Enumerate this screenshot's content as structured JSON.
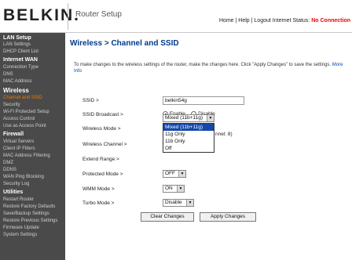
{
  "header": {
    "logo": "BELKIN",
    "logo_dot": ".",
    "title": "Router Setup",
    "nav_home": "Home",
    "nav_help": "Help",
    "nav_logout": "Logout",
    "nav_sep": " | ",
    "status_label": "Internet Status:",
    "status_value": "No Connection"
  },
  "sidebar": {
    "lan_head": "LAN Setup",
    "lan_items": [
      "LAN Settings",
      "DHCP Client List"
    ],
    "wan_head": "Internet WAN",
    "wan_items": [
      "Connection Type",
      "DNS",
      "MAC Address"
    ],
    "wireless_head": "Wireless",
    "wireless_items": [
      "Channel and SSID",
      "Security",
      "Wi-Fi Protected Setup",
      "Access Control",
      "Use as Access Point"
    ],
    "firewall_head": "Firewall",
    "firewall_items": [
      "Virtual Servers",
      "Client IP Filters",
      "MAC Address Filtering",
      "DMZ",
      "DDNS",
      "WAN Ping Blocking",
      "Security Log"
    ],
    "utilities_head": "Utilities",
    "utilities_items": [
      "Restart Router",
      "Restore Factory Defaults",
      "Save/Backup Settings",
      "Restore Previous Settings",
      "Firmware Update",
      "System Settings"
    ]
  },
  "main": {
    "title": "Wireless > Channel and SSID",
    "intro": "To make changes to the wireless settings of the router, make the changes here. Click \"Apply Changes\" to save the settings.",
    "more_info": "More Info",
    "ssid_label": "SSID >",
    "ssid_value": "belkin54g",
    "broadcast_label": "SSID Broadcast >",
    "broadcast_enable": "Enable",
    "broadcast_disable": "Disable",
    "mode_label": "Wireless Mode >",
    "mode_value": "Mixed (11b+11g)",
    "mode_options": [
      "Mixed (11b+11g)",
      "11g Only",
      "11b Only",
      "Off"
    ],
    "channel_label": "Wireless Channel >",
    "channel_peek": "nnel: 8)",
    "range_label": "Extend Range >",
    "protected_label": "Protected Mode >",
    "protected_value": "OFF",
    "wmm_label": "WMM Mode >",
    "wmm_value": "ON",
    "turbo_label": "Turbo Mode >",
    "turbo_value": "Disable",
    "clear_btn": "Clear Changes",
    "apply_btn": "Apply Changes"
  },
  "colors": {
    "sidebar_bg": "#4a4a4a",
    "active": "#f07800",
    "title": "#003a8c",
    "status_alert": "#e00000"
  }
}
